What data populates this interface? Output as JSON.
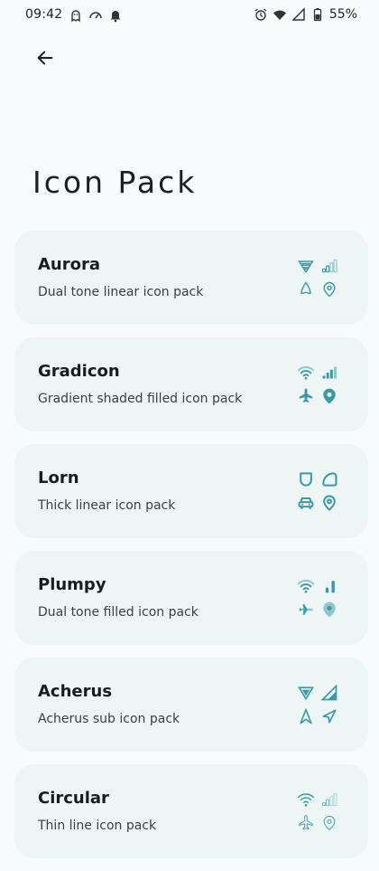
{
  "status_bar": {
    "time": "09:42",
    "battery": "55%",
    "left_icons": [
      "ghost-icon",
      "speed-icon",
      "notification-bell-icon"
    ],
    "right_icons": [
      "alarm-icon",
      "wifi-icon",
      "signal-icon",
      "battery-icon"
    ]
  },
  "header": {
    "back_icon": "arrow-left-icon",
    "title": "Icon Pack"
  },
  "accent_color": "#3a9aa3",
  "packs": [
    {
      "name": "Aurora",
      "description": "Dual tone linear icon pack",
      "style": "linear",
      "icons": [
        "wifi-icon",
        "signal-icon",
        "airplane-icon",
        "location-icon"
      ]
    },
    {
      "name": "Gradicon",
      "description": "Gradient shaded filled icon pack",
      "style": "filled",
      "icons": [
        "wifi-icon",
        "signal-icon",
        "airplane-icon",
        "location-icon"
      ]
    },
    {
      "name": "Lorn",
      "description": "Thick linear icon pack",
      "style": "thick",
      "icons": [
        "shield-icon",
        "blob-icon",
        "car-icon",
        "location-icon"
      ]
    },
    {
      "name": "Plumpy",
      "description": "Dual tone filled icon pack",
      "style": "dualtone",
      "icons": [
        "wifi-icon",
        "signal-icon",
        "airplane-icon",
        "location-icon"
      ]
    },
    {
      "name": "Acherus",
      "description": "Acherus sub icon pack",
      "style": "angular",
      "icons": [
        "wifi-icon",
        "signal-icon",
        "airplane-icon",
        "location-icon"
      ]
    },
    {
      "name": "Circular",
      "description": "Thin line icon pack",
      "style": "thin",
      "icons": [
        "wifi-icon",
        "signal-icon",
        "airplane-icon",
        "location-icon"
      ]
    }
  ]
}
